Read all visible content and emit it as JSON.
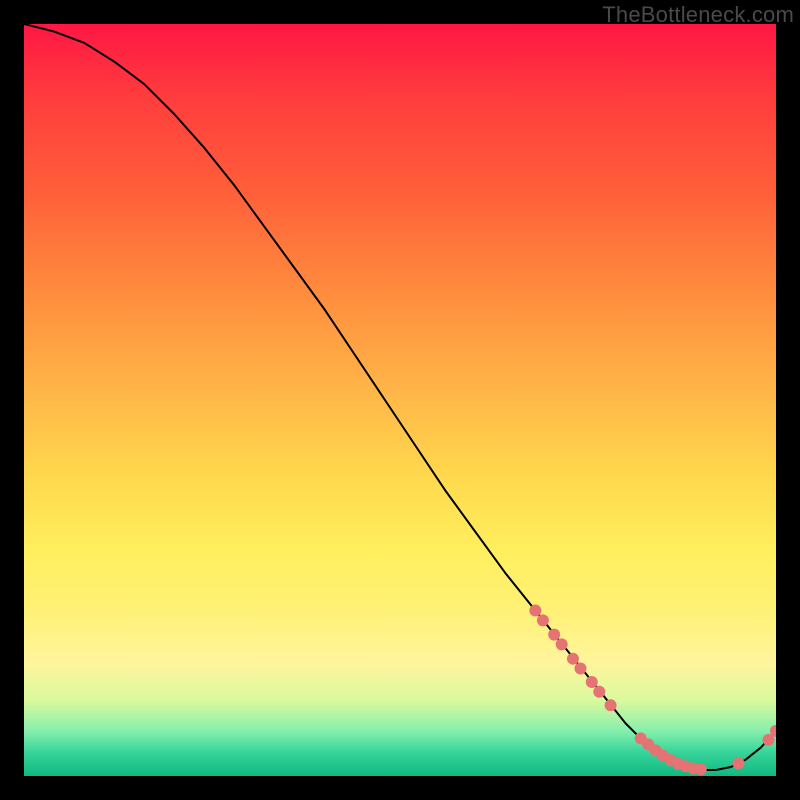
{
  "watermark": "TheBottleneck.com",
  "chart_data": {
    "type": "line",
    "title": "",
    "xlabel": "",
    "ylabel": "",
    "xlim": [
      0,
      100
    ],
    "ylim": [
      0,
      100
    ],
    "grid": false,
    "legend": false,
    "series": [
      {
        "name": "curve",
        "color": "#000000",
        "x": [
          0,
          4,
          8,
          12,
          16,
          20,
          24,
          28,
          32,
          36,
          40,
          44,
          48,
          52,
          56,
          60,
          64,
          68,
          72,
          74,
          76,
          78,
          80,
          82,
          84,
          86,
          88,
          90,
          92,
          94,
          96,
          98,
          100
        ],
        "y": [
          100,
          99,
          97.5,
          95,
          92,
          88,
          83.5,
          78.5,
          73,
          67.5,
          62,
          56,
          50,
          44,
          38,
          32.5,
          27,
          22,
          17,
          14.5,
          12,
          9.5,
          7,
          5,
          3.3,
          2,
          1.2,
          0.8,
          0.8,
          1.2,
          2.2,
          3.8,
          6
        ]
      }
    ],
    "markers": [
      {
        "x": 68.0,
        "y": 22.0
      },
      {
        "x": 69.0,
        "y": 20.7
      },
      {
        "x": 70.5,
        "y": 18.8
      },
      {
        "x": 71.5,
        "y": 17.5
      },
      {
        "x": 73.0,
        "y": 15.6
      },
      {
        "x": 74.0,
        "y": 14.3
      },
      {
        "x": 75.5,
        "y": 12.5
      },
      {
        "x": 76.5,
        "y": 11.2
      },
      {
        "x": 78.0,
        "y": 9.4
      },
      {
        "x": 82.0,
        "y": 5.0
      },
      {
        "x": 83.0,
        "y": 4.2
      },
      {
        "x": 84.0,
        "y": 3.4
      },
      {
        "x": 85.0,
        "y": 2.7
      },
      {
        "x": 86.0,
        "y": 2.1
      },
      {
        "x": 87.0,
        "y": 1.6
      },
      {
        "x": 88.0,
        "y": 1.3
      },
      {
        "x": 89.0,
        "y": 1.0
      },
      {
        "x": 90.0,
        "y": 0.9
      },
      {
        "x": 95.0,
        "y": 1.7
      },
      {
        "x": 99.0,
        "y": 4.8
      },
      {
        "x": 100.0,
        "y": 6.0
      }
    ],
    "marker_color": "#e57373",
    "marker_radius_px": 6
  }
}
